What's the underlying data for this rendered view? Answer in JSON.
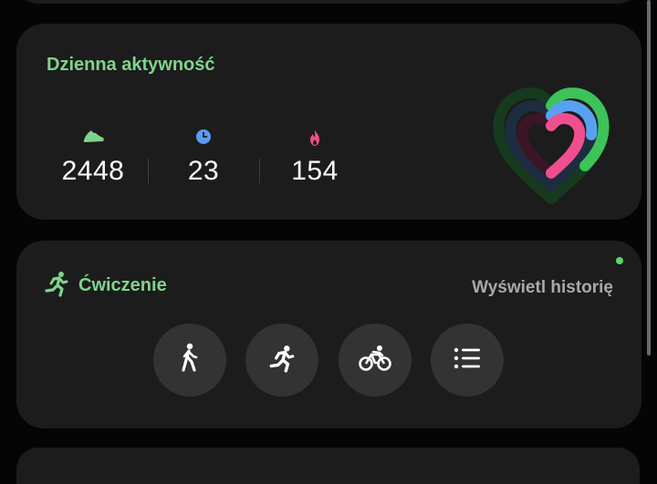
{
  "daily_activity": {
    "title": "Dzienna aktywność",
    "stats": [
      {
        "icon": "shoe-icon",
        "value": "2448",
        "color": "#7fd48c"
      },
      {
        "icon": "clock-icon",
        "value": "23",
        "color": "#5b9cf0"
      },
      {
        "icon": "flame-icon",
        "value": "154",
        "color": "#f0508c"
      }
    ],
    "rings": {
      "steps_color": "#3cc35a",
      "time_color": "#5aa0f0",
      "calories_color": "#f04f8f",
      "steps_progress": 0.25,
      "time_progress": 0.38,
      "calories_progress": 0.5
    }
  },
  "exercise": {
    "title": "Ćwiczenie",
    "history_link": "Wyświetl historię",
    "icon": "running-person-icon",
    "buttons": [
      {
        "icon": "walking-icon"
      },
      {
        "icon": "running-icon"
      },
      {
        "icon": "cycling-icon"
      },
      {
        "icon": "list-icon"
      }
    ],
    "status_dot_color": "#5cd36b"
  },
  "colors": {
    "background": "#050505",
    "card": "#1c1c1c",
    "accent_green": "#7fd48c",
    "button_bg": "#333333"
  }
}
